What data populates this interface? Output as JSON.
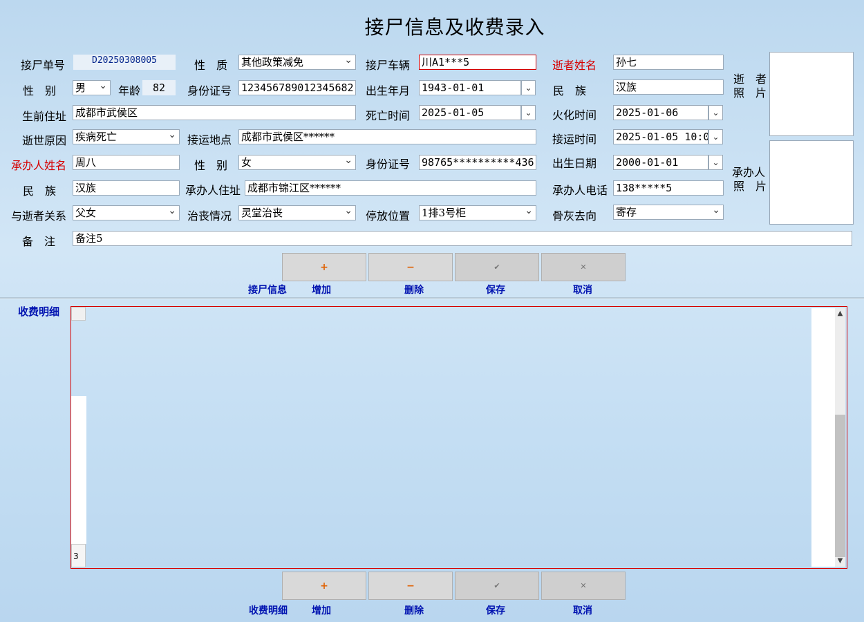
{
  "title": "接尸信息及收费录入",
  "form": {
    "order_no_label": "接尸单号",
    "order_no": "D20250308005",
    "nature_label": "性　质",
    "nature": "其他政策减免",
    "vehicle_label": "接尸车辆",
    "vehicle": "川A1***5",
    "deceased_name_label": "逝者姓名",
    "deceased_name": "孙七",
    "gender_label": "性　别",
    "gender": "男",
    "age_label": "年龄",
    "age": "82",
    "id_label": "身份证号",
    "id_no": "123456789012345682",
    "birth_month_label": "出生年月",
    "birth_month": "1943-01-01",
    "ethnicity_label": "民　族",
    "ethnicity": "汉族",
    "address_label": "生前住址",
    "address": "成都市武侯区",
    "death_time_label": "死亡时间",
    "death_time": "2025-01-05",
    "cremation_time_label": "火化时间",
    "cremation_time": "2025-01-06",
    "cause_label": "逝世原因",
    "cause": "疾病死亡",
    "pickup_place_label": "接运地点",
    "pickup_place": "成都市武侯区******",
    "pickup_time_label": "接运时间",
    "pickup_time": "2025-01-05 10:0",
    "handler_name_label": "承办人姓名",
    "handler_name": "周八",
    "handler_gender_label": "性　别",
    "handler_gender": "女",
    "handler_id_label": "身份证号",
    "handler_id": "98765**********436",
    "handler_birth_label": "出生日期",
    "handler_birth": "2000-01-01",
    "handler_ethnicity_label": "民　族",
    "handler_ethnicity": "汉族",
    "handler_address_label": "承办人住址",
    "handler_address": "成都市锦江区******",
    "handler_phone_label": "承办人电话",
    "handler_phone": "138*****5",
    "relation_label": "与逝者关系",
    "relation": "父女",
    "funeral_label": "治丧情况",
    "funeral": "灵堂治丧",
    "storage_label": "停放位置",
    "storage": "1排3号柜",
    "ashes_label": "骨灰去向",
    "ashes": "寄存",
    "remark_label": "备　注",
    "remark": "备注5",
    "deceased_photo_label_1": "逝　者",
    "deceased_photo_label_2": "照　片",
    "handler_photo_label_1": "承办人",
    "handler_photo_label_2": "照　片"
  },
  "toolbar1": {
    "section": "接尸信息",
    "add": "增加",
    "delete": "删除",
    "save": "保存",
    "cancel": "取消"
  },
  "grid": {
    "label": "收费明细",
    "row_indicator": "3"
  },
  "toolbar2": {
    "section": "收费明细",
    "add": "增加",
    "delete": "删除",
    "save": "保存",
    "cancel": "取消"
  },
  "icons": {
    "add": "+",
    "delete": "−",
    "save": "✔",
    "cancel": "✕"
  },
  "colors": {
    "required_label": "#d60000",
    "button_label": "#0012b0"
  }
}
